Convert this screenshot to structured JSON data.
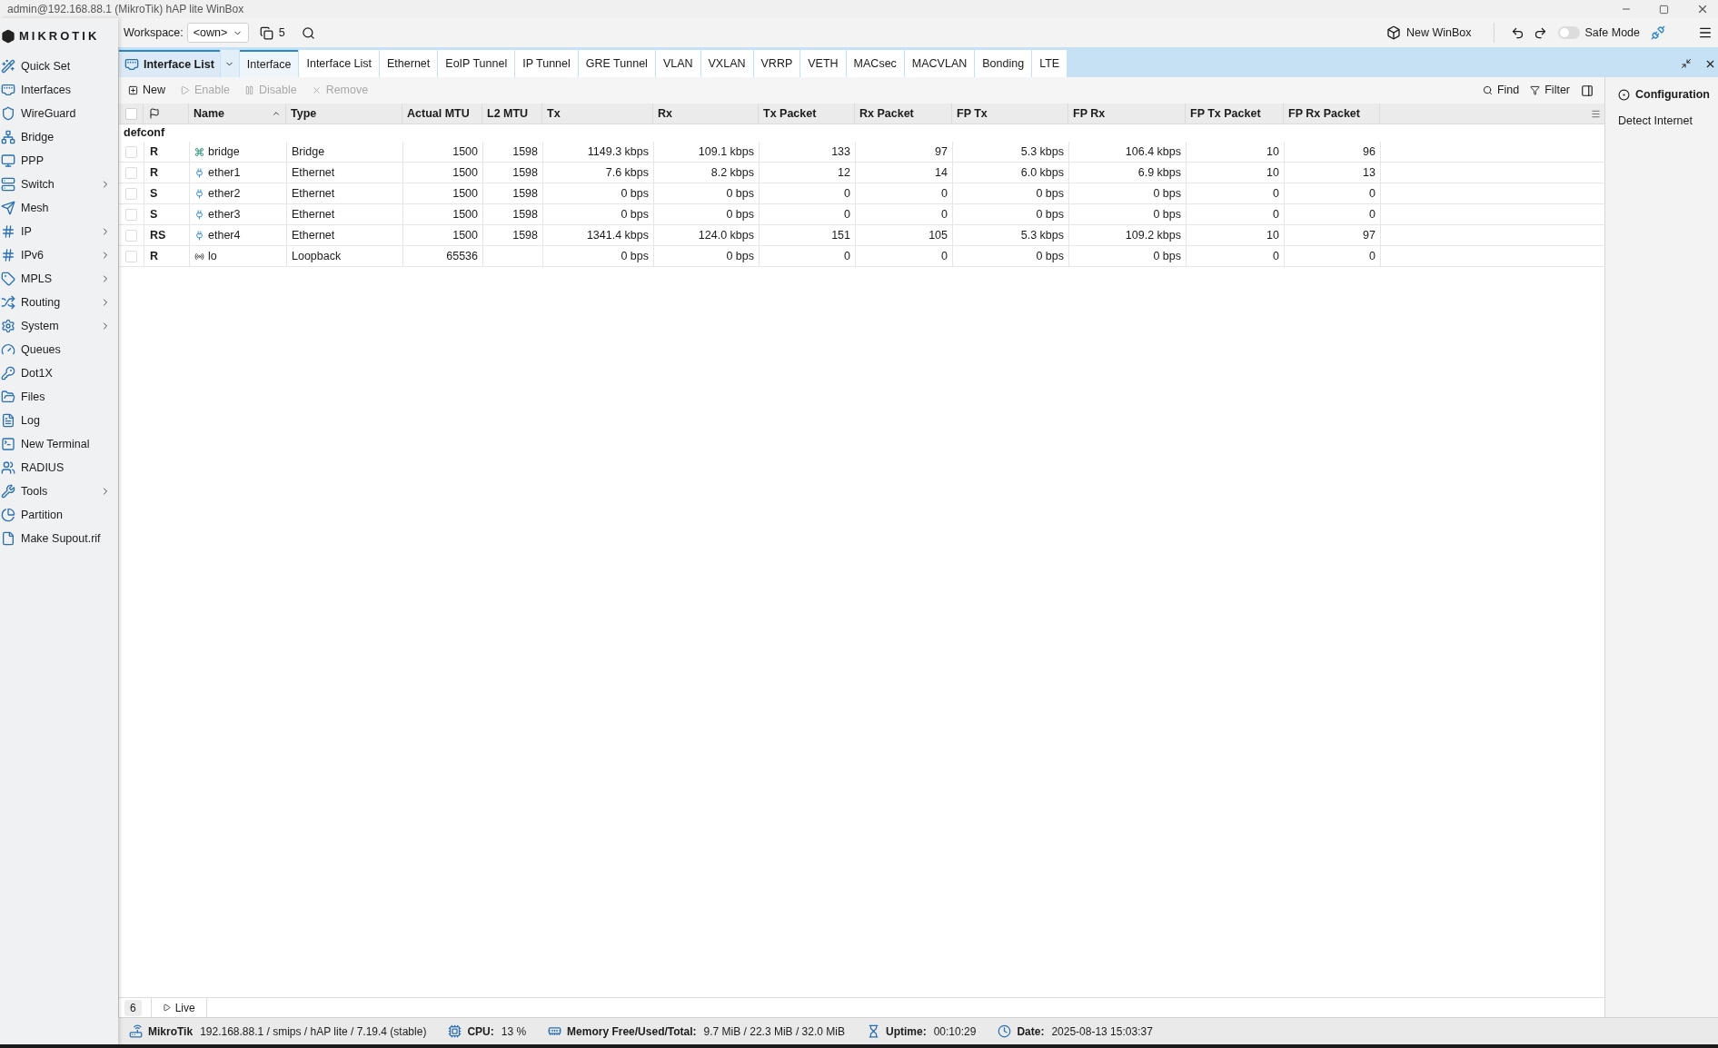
{
  "window": {
    "title": "admin@192.168.88.1 (MikroTik) hAP lite WinBox"
  },
  "logo": {
    "text": "MIKROTIK"
  },
  "sidebar": {
    "items": [
      {
        "label": "Quick Set",
        "submenu": false
      },
      {
        "label": "Interfaces",
        "submenu": false
      },
      {
        "label": "WireGuard",
        "submenu": false
      },
      {
        "label": "Bridge",
        "submenu": false
      },
      {
        "label": "PPP",
        "submenu": false
      },
      {
        "label": "Switch",
        "submenu": true
      },
      {
        "label": "Mesh",
        "submenu": false
      },
      {
        "label": "IP",
        "submenu": true
      },
      {
        "label": "IPv6",
        "submenu": true
      },
      {
        "label": "MPLS",
        "submenu": true
      },
      {
        "label": "Routing",
        "submenu": true
      },
      {
        "label": "System",
        "submenu": true
      },
      {
        "label": "Queues",
        "submenu": false
      },
      {
        "label": "Dot1X",
        "submenu": false
      },
      {
        "label": "Files",
        "submenu": false
      },
      {
        "label": "Log",
        "submenu": false
      },
      {
        "label": "New Terminal",
        "submenu": false
      },
      {
        "label": "RADIUS",
        "submenu": false
      },
      {
        "label": "Tools",
        "submenu": true
      },
      {
        "label": "Partition",
        "submenu": false
      },
      {
        "label": "Make Supout.rif",
        "submenu": false
      }
    ]
  },
  "topbar": {
    "workspace_label": "Workspace:",
    "workspace_value": "<own>",
    "window_count": "5",
    "new_winbox": "New WinBox",
    "safe_mode": {
      "label": "Safe Mode",
      "on": false
    }
  },
  "panel": {
    "title": "Interface List",
    "tabs": [
      {
        "label": "Interface",
        "selected": true
      },
      {
        "label": "Interface List",
        "selected": false
      },
      {
        "label": "Ethernet",
        "selected": false
      },
      {
        "label": "EoIP Tunnel",
        "selected": false
      },
      {
        "label": "IP Tunnel",
        "selected": false
      },
      {
        "label": "GRE Tunnel",
        "selected": false
      },
      {
        "label": "VLAN",
        "selected": false
      },
      {
        "label": "VXLAN",
        "selected": false
      },
      {
        "label": "VRRP",
        "selected": false
      },
      {
        "label": "VETH",
        "selected": false
      },
      {
        "label": "MACsec",
        "selected": false
      },
      {
        "label": "MACVLAN",
        "selected": false
      },
      {
        "label": "Bonding",
        "selected": false
      },
      {
        "label": "LTE",
        "selected": false
      }
    ],
    "toolbar": [
      {
        "kind": "new",
        "label": "New",
        "disabled": false
      },
      {
        "kind": "enable",
        "label": "Enable",
        "disabled": true
      },
      {
        "kind": "disable",
        "label": "Disable",
        "disabled": true
      },
      {
        "kind": "remove",
        "label": "Remove",
        "disabled": true
      }
    ],
    "find": "Find",
    "filter": "Filter",
    "table": {
      "all_checked": false,
      "columns": [
        {
          "label": "Name",
          "sorted": true
        },
        {
          "label": "Type",
          "sorted": false
        },
        {
          "label": "Actual MTU",
          "sorted": false
        },
        {
          "label": "L2 MTU",
          "sorted": false
        },
        {
          "label": "Tx",
          "sorted": false
        },
        {
          "label": "Rx",
          "sorted": false
        },
        {
          "label": "Tx Packet",
          "sorted": false
        },
        {
          "label": "Rx Packet",
          "sorted": false
        },
        {
          "label": "FP Tx",
          "sorted": false
        },
        {
          "label": "FP Rx",
          "sorted": false
        },
        {
          "label": "FP Tx Packet",
          "sorted": false
        },
        {
          "label": "FP Rx Packet",
          "sorted": false
        }
      ],
      "group": "defconf",
      "rows": [
        {
          "checked": false,
          "flags": "R",
          "kind": "bridge",
          "cells": [
            "bridge",
            "Bridge",
            "1500",
            "1598",
            "1149.3 kbps",
            "109.1 kbps",
            "133",
            "97",
            "5.3 kbps",
            "106.4 kbps",
            "10",
            "96"
          ]
        },
        {
          "checked": false,
          "flags": "R",
          "kind": "ethernet",
          "cells": [
            "ether1",
            "Ethernet",
            "1500",
            "1598",
            "7.6 kbps",
            "8.2 kbps",
            "12",
            "14",
            "6.0 kbps",
            "6.9 kbps",
            "10",
            "13"
          ]
        },
        {
          "checked": false,
          "flags": "S",
          "kind": "ethernet",
          "cells": [
            "ether2",
            "Ethernet",
            "1500",
            "1598",
            "0 bps",
            "0 bps",
            "0",
            "0",
            "0 bps",
            "0 bps",
            "0",
            "0"
          ]
        },
        {
          "checked": false,
          "flags": "S",
          "kind": "ethernet",
          "cells": [
            "ether3",
            "Ethernet",
            "1500",
            "1598",
            "0 bps",
            "0 bps",
            "0",
            "0",
            "0 bps",
            "0 bps",
            "0",
            "0"
          ]
        },
        {
          "checked": false,
          "flags": "RS",
          "kind": "ethernet",
          "cells": [
            "ether4",
            "Ethernet",
            "1500",
            "1598",
            "1341.4 kbps",
            "124.0 kbps",
            "151",
            "105",
            "5.3 kbps",
            "109.2 kbps",
            "10",
            "97"
          ]
        },
        {
          "checked": false,
          "flags": "R",
          "kind": "loopback",
          "cells": [
            "lo",
            "Loopback",
            "65536",
            "",
            "0 bps",
            "0 bps",
            "0",
            "0",
            "0 bps",
            "0 bps",
            "0",
            "0"
          ]
        }
      ]
    },
    "footer": {
      "count": "6",
      "live": "Live"
    }
  },
  "side_panel": {
    "title": "Configuration",
    "items": [
      "Detect Internet"
    ]
  },
  "status_bar": [
    {
      "kind": "device",
      "label": "MikroTik",
      "value": "192.168.88.1 / smips / hAP lite / 7.19.4 (stable)"
    },
    {
      "kind": "cpu",
      "label": "CPU:",
      "value": "13 %"
    },
    {
      "kind": "memory",
      "label": "Memory Free/Used/Total:",
      "value": "9.7 MiB / 22.3 MiB / 32.0 MiB"
    },
    {
      "kind": "uptime",
      "label": "Uptime:",
      "value": "00:10:29"
    },
    {
      "kind": "date",
      "label": "Date:",
      "value": "2025-08-13 15:03:37"
    }
  ]
}
